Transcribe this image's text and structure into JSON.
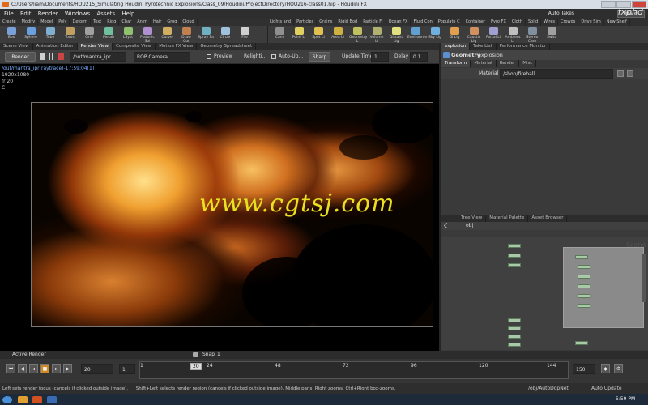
{
  "window": {
    "title": "C:/Users/liam/Documents/HOU215_Simulating Houdini Pyrotechnic Explosions/Class_09/Houdini/ProjectDirectory/HOU216-class01.hip - Houdini FX"
  },
  "menu": {
    "items": [
      "File",
      "Edit",
      "Render",
      "Windows",
      "Assets",
      "Help"
    ],
    "auto_takes": "Auto Takes",
    "main": "Main",
    "logo": "fxphd"
  },
  "shelf_left": {
    "tabs": [
      "Create",
      "Modify",
      "Model",
      "Poly",
      "Deform",
      "Text",
      "Rigg",
      "Char",
      "Anim",
      "Hair",
      "Grog",
      "Cloud"
    ],
    "tools": [
      "Box",
      "Sphere",
      "Tube",
      "Torus",
      "Grid",
      "Metab",
      "LSyst",
      "Platonic Sol",
      "Curve",
      "Draw Cur",
      "Spray Pa",
      "Circle",
      "File"
    ]
  },
  "shelf_right": {
    "tabs": [
      "Lights and",
      "Particles",
      "Grains",
      "Rigid Bod",
      "Particle Fl",
      "Ocean FX",
      "Fluid Con",
      "Populate C",
      "Container",
      "Pyro FX",
      "Cloth",
      "Solid",
      "Wires",
      "Crowds",
      "Drive Sim",
      "New Shelf"
    ],
    "tools": [
      "Cam",
      "Point Li",
      "Spot Li",
      "Area Li",
      "Geometry L",
      "Volume Li",
      "Distant Lig",
      "Environme",
      "Sky Lig",
      "GI Lig",
      "Caustic Lig",
      "Portal Li",
      "Ambient Li",
      "Stereo Cam",
      "Switc"
    ]
  },
  "left_pane_tabs": [
    "Scene View",
    "Animation Editor",
    "Render View",
    "Composite View",
    "Motion FX View",
    "Geometry Spreadsheet"
  ],
  "render_toolbar": {
    "render_btn": "Render",
    "output_path": "/out/mantra_ipr",
    "camera": "ROP Camera",
    "preview": "Preview",
    "relight": "Relighti...",
    "auto_update": "Auto-Up...",
    "sharp": "Sharp",
    "update_time_label": "Update Time",
    "update_time_value": "1",
    "delay_label": "Delay",
    "delay_value": "0.1"
  },
  "render_view": {
    "render_label": "/out/mantra_ipr(raytrace)-17:59:04[1]",
    "resolution": "1920x1080",
    "frame": "fr 20",
    "channel": "C",
    "watermark": "www.cgtsj.com"
  },
  "right_pane_tabs": [
    "explosion",
    "Take List",
    "Performance Monitor"
  ],
  "parameters": {
    "node_type": "Geometry",
    "node_name": "explosion",
    "tabs": [
      "Transform",
      "Material",
      "Render",
      "Misc"
    ],
    "material_label": "Material",
    "material_value": "/shop/fireball"
  },
  "network": {
    "tabs": [
      "Tree View",
      "Material Palette",
      "Asset Browser"
    ],
    "path": "obj",
    "scene_label": "Scene"
  },
  "timeline": {
    "active_render": "Active Render",
    "snap_label": "Snap",
    "snap_value": "1",
    "current_frame": "20",
    "start_frame": "1",
    "end_frame": "150",
    "ticks": [
      "1",
      "20",
      "24",
      "48",
      "72",
      "96",
      "120",
      "144"
    ],
    "auto_update": "Auto Update",
    "net_path": "/obj/AutoDopNet"
  },
  "status": {
    "left": "Left sets render focus (cancels if clicked outside image).",
    "right": "Shift+Left selects render region (cancels if clicked outside image). Middle pans. Right zooms. Ctrl+Right box-zooms."
  },
  "taskbar": {
    "time": "5:59 PM"
  }
}
